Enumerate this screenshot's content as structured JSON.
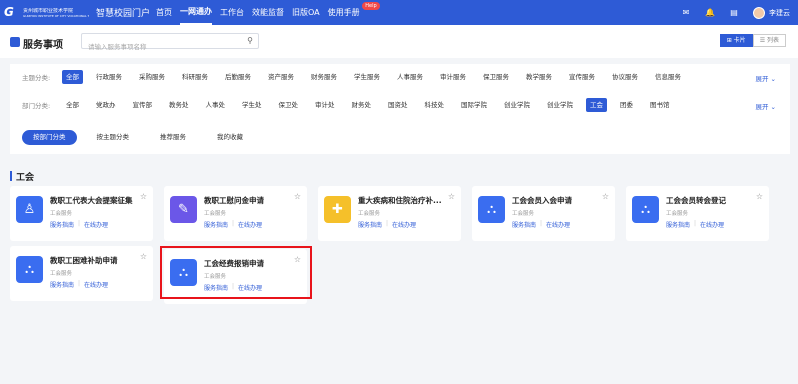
{
  "header_bar": {
    "logo_text": "贵州城市职业技术学院",
    "logo_subtext": "GUIZHOU INSTITUTE OF CITY VOCATIONAL TECHNOLOGY",
    "portal_name": "智慧校园门户",
    "nav": [
      "首页",
      "一网通办",
      "工作台",
      "效能监督",
      "旧版OA",
      "使用手册"
    ],
    "help_badge": "Help",
    "username": "李建云"
  },
  "page": {
    "title": "服务事项",
    "search_placeholder": "请输入服务事项名称",
    "view_card": "卡片",
    "view_list": "列表"
  },
  "filters": {
    "theme_label": "主题分类:",
    "theme_items": [
      "全部",
      "行政服务",
      "采购服务",
      "科研服务",
      "后勤服务",
      "资产服务",
      "财务服务",
      "学生服务",
      "人事服务",
      "审计服务",
      "保卫服务",
      "教学服务",
      "宣传服务",
      "协议服务",
      "信息服务"
    ],
    "dept_label": "部门分类:",
    "dept_items": [
      "全部",
      "党政办",
      "宣传部",
      "教务处",
      "人事处",
      "学生处",
      "保卫处",
      "审计处",
      "财务处",
      "国资处",
      "科技处",
      "国际学院",
      "创业学院",
      "创业学院",
      "工会",
      "团委",
      "图书馆"
    ],
    "expand_label": "展开",
    "tabs": [
      "按部门分类",
      "按主题分类",
      "推荐服务",
      "我的收藏"
    ]
  },
  "section": {
    "title": "工会"
  },
  "cards": [
    {
      "name": "教职工代表大会提案征集",
      "category": "工会服务",
      "guide": "服务指南",
      "online": "在线办理"
    },
    {
      "name": "教职工慰问金申请",
      "category": "工会服务",
      "guide": "服务指南",
      "online": "在线办理"
    },
    {
      "name": "重大疾病和住院治疗补...",
      "category": "工会服务",
      "guide": "服务指南",
      "online": "在线办理"
    },
    {
      "name": "工会会员入会申请",
      "category": "工会服务",
      "guide": "服务指南",
      "online": "在线办理"
    },
    {
      "name": "工会会员转会登记",
      "category": "工会服务",
      "guide": "服务指南",
      "online": "在线办理"
    },
    {
      "name": "教职工困难补助申请",
      "category": "工会服务",
      "guide": "服务指南",
      "online": "在线办理"
    },
    {
      "name": "工会经费报销申请",
      "category": "工会服务",
      "guide": "服务指南",
      "online": "在线办理"
    }
  ],
  "colors": {
    "primary": "#2e5bd6",
    "highlight": "#e8141b"
  }
}
